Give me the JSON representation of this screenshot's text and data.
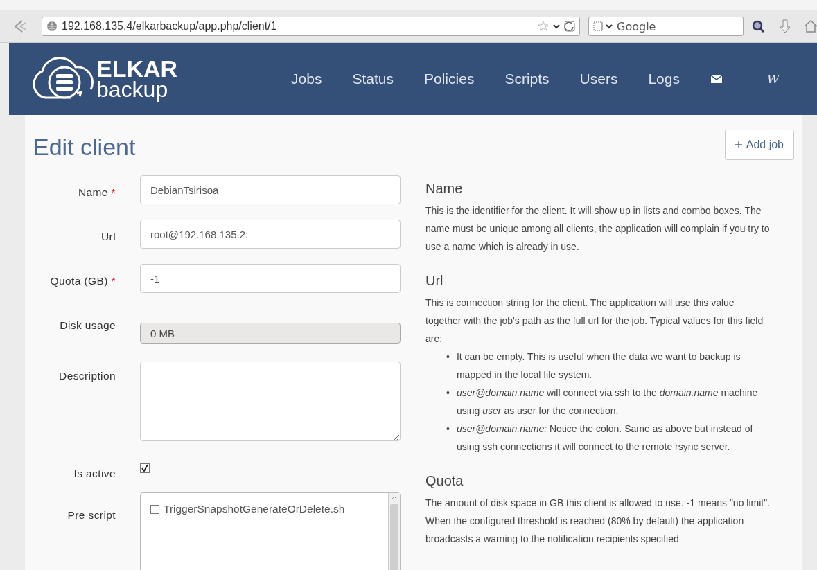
{
  "browser": {
    "url": "192.168.135.4/elkarbackup/app.php/client/1",
    "search": {
      "placeholder": "Google"
    }
  },
  "nav": {
    "logo": {
      "line_1": "ELKAR",
      "line_2": "backup"
    },
    "items": [
      {
        "label": "Jobs"
      },
      {
        "label": "Status"
      },
      {
        "label": "Policies"
      },
      {
        "label": "Scripts"
      },
      {
        "label": "Users"
      },
      {
        "label": "Logs"
      }
    ],
    "user_label": "W"
  },
  "page": {
    "title": "Edit client",
    "add_button": "Add job"
  },
  "form": {
    "fields": [
      {
        "kind": "text",
        "label": "Name",
        "required_mark": "*",
        "value": "DebianTsirisoa"
      },
      {
        "kind": "text",
        "label": "Url",
        "value": "root@192.168.135.2:"
      },
      {
        "kind": "text",
        "label": "Quota (GB)",
        "required_mark": "*",
        "value": "-1"
      },
      {
        "kind": "readonly",
        "label": "Disk usage",
        "value": "0 MB"
      },
      {
        "kind": "textarea",
        "label": "Description"
      },
      {
        "kind": "checkbox",
        "label": "Is active",
        "checked": true
      },
      {
        "kind": "checklist",
        "label": "Pre script",
        "options": [
          {
            "label": "TriggerSnapshotGenerateOrDelete.sh",
            "checked": false
          }
        ]
      }
    ]
  },
  "help": {
    "sections": [
      {
        "heading": "Name",
        "paragraphs": [
          "This is the identifier for the client. It will show up in lists and combo boxes. The name must be unique among all clients, the application will complain if you try to use a name which is already in use."
        ]
      },
      {
        "heading": "Url",
        "paragraphs": [
          "This is connection string for the client. The application will use this value together with the job's path as the full url for the job. Typical values for this field are:"
        ],
        "list": [
          {
            "bullet": "•",
            "text": "It can be empty. This is useful when the data we want to backup is mapped in the local file system."
          },
          {
            "bullet": "•",
            "text": "*user@domain.name* will connect via ssh to the *domain.name* machine using *user* as user for the connection."
          },
          {
            "bullet": "•",
            "text": "*user@domain.name:* Notice the colon. Same as above but instead of using ssh connections it will connect to the remote rsync server."
          }
        ]
      },
      {
        "heading": "Quota",
        "paragraphs": [
          "The amount of disk space in GB this client is allowed to use. -1 means \"no limit\". When the configured threshold is reached (80% by default) the application broadcasts a warning to the notification recipients specified"
        ]
      }
    ]
  }
}
